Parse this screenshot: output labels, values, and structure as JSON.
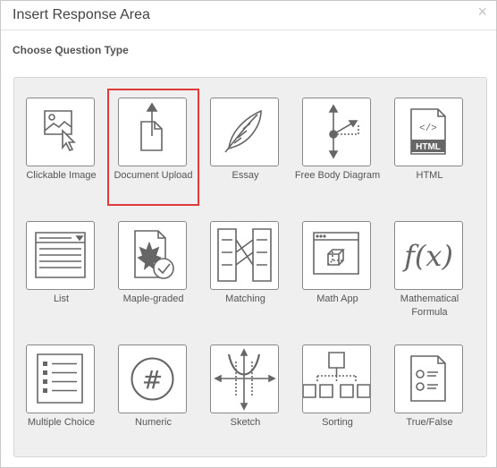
{
  "dialog": {
    "title": "Insert Response Area",
    "close_label": "×",
    "section_label": "Choose Question Type"
  },
  "tiles": [
    {
      "label": "Clickable Image",
      "icon": "clickable-image-icon"
    },
    {
      "label": "Document Upload",
      "icon": "document-upload-icon",
      "selected": true
    },
    {
      "label": "Essay",
      "icon": "essay-icon"
    },
    {
      "label": "Free Body Diagram",
      "icon": "free-body-diagram-icon"
    },
    {
      "label": "HTML",
      "icon": "html-icon",
      "icon_text": "HTML",
      "icon_code": "</>"
    },
    {
      "label": "List",
      "icon": "list-icon"
    },
    {
      "label": "Maple-graded",
      "icon": "maple-graded-icon"
    },
    {
      "label": "Matching",
      "icon": "matching-icon"
    },
    {
      "label": "Math App",
      "icon": "math-app-icon"
    },
    {
      "label": "Mathematical Formula",
      "icon": "mathematical-formula-icon",
      "icon_text": "f(x)"
    },
    {
      "label": "Multiple Choice",
      "icon": "multiple-choice-icon"
    },
    {
      "label": "Numeric",
      "icon": "numeric-icon",
      "icon_text": "#"
    },
    {
      "label": "Sketch",
      "icon": "sketch-icon"
    },
    {
      "label": "Sorting",
      "icon": "sorting-icon"
    },
    {
      "label": "True/False",
      "icon": "true-false-icon"
    }
  ],
  "colors": {
    "selection": "#e03a3a",
    "icon": "#666666"
  }
}
